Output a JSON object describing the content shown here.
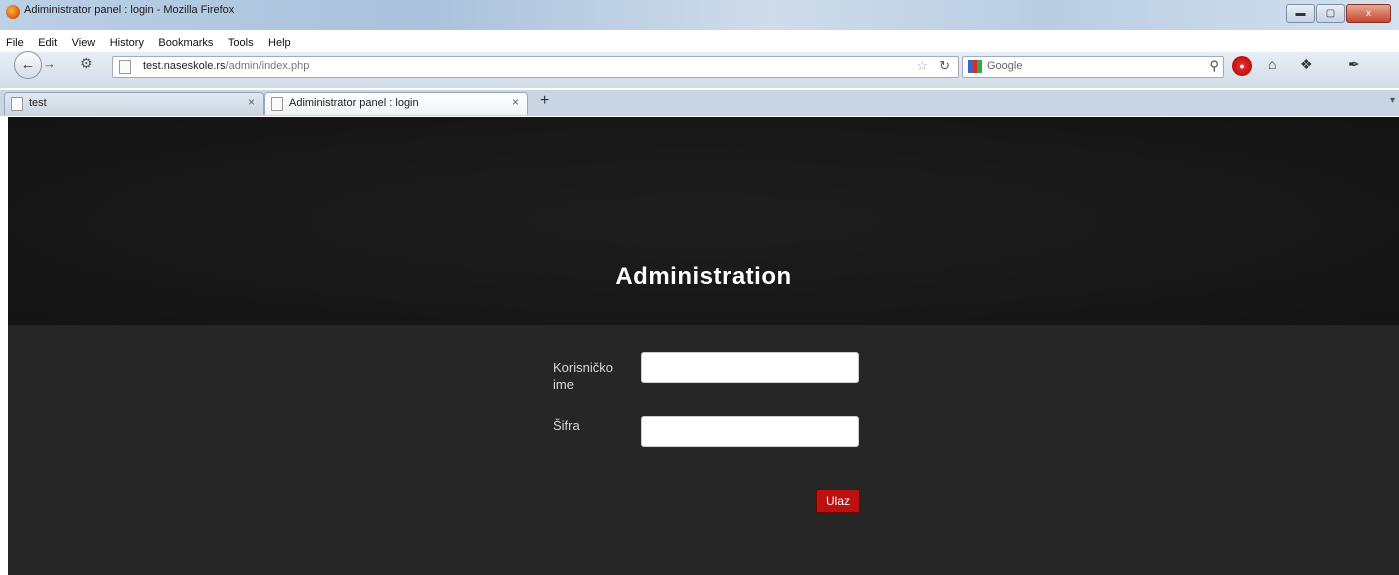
{
  "window": {
    "title": "Adiministrator panel : login - Mozilla Firefox",
    "controls": {
      "minimize": "▬",
      "maximize": "▢",
      "close": "x"
    }
  },
  "menu": [
    "File",
    "Edit",
    "View",
    "History",
    "Bookmarks",
    "Tools",
    "Help"
  ],
  "navigation": {
    "back_icon": "back-arrow-icon",
    "forward_icon": "forward-arrow-icon",
    "url_host": "test.naseskole.rs",
    "url_path": "/admin/index.php",
    "search_engine": "Google",
    "search_placeholder": "Google"
  },
  "tabs": [
    {
      "label": "test",
      "active": false
    },
    {
      "label": "Adiministrator panel : login",
      "active": true
    }
  ],
  "page": {
    "heading": "Administration",
    "username_label": "Korisničko ime",
    "password_label": "Šifra",
    "username_value": "",
    "password_value": "",
    "submit_label": "Ulaz",
    "colors": {
      "header_bg": "#181818",
      "form_bg": "#262626",
      "submit_bg": "#b11111",
      "heading_color": "#ffffff"
    }
  }
}
